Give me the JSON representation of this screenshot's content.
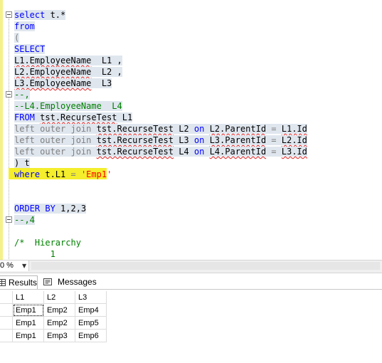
{
  "editor": {
    "lines": [
      [
        {
          "t": "select t.*",
          "c": "kw-first"
        }
      ],
      [
        {
          "t": "from",
          "c": "kw"
        }
      ],
      [
        {
          "t": "(",
          "c": "gray"
        }
      ],
      [
        {
          "t": "SELECT",
          "c": "kw"
        }
      ],
      [
        {
          "t": "L1.EmployeeName",
          "c": "err"
        },
        {
          "t": "  L1 ,",
          "c": "plain"
        }
      ],
      [
        {
          "t": "L2.EmployeeName",
          "c": "err"
        },
        {
          "t": "  L2 ,",
          "c": "plain"
        }
      ],
      [
        {
          "t": "L3.EmployeeName",
          "c": "err"
        },
        {
          "t": "  L3",
          "c": "plain"
        }
      ],
      [
        {
          "t": "--,",
          "c": "grn"
        }
      ],
      [
        {
          "t": "--L4.EmployeeName  L4",
          "c": "grn"
        }
      ],
      [
        {
          "t": "FROM",
          "c": "kw"
        },
        {
          "t": " ",
          "c": "plain"
        },
        {
          "t": "tst.RecurseTest",
          "c": "err"
        },
        {
          "t": " L1",
          "c": "plain"
        }
      ],
      [
        {
          "t": "left outer join",
          "c": "gray"
        },
        {
          "t": " ",
          "c": "plain"
        },
        {
          "t": "tst.RecurseTest",
          "c": "err"
        },
        {
          "t": " L2 ",
          "c": "plain"
        },
        {
          "t": "on",
          "c": "kw"
        },
        {
          "t": " ",
          "c": "plain"
        },
        {
          "t": "L2.ParentId",
          "c": "err"
        },
        {
          "t": " = ",
          "c": "gray"
        },
        {
          "t": "L1.Id",
          "c": "err"
        }
      ],
      [
        {
          "t": "left outer join",
          "c": "gray"
        },
        {
          "t": " ",
          "c": "plain"
        },
        {
          "t": "tst.RecurseTest",
          "c": "err"
        },
        {
          "t": " L3 ",
          "c": "plain"
        },
        {
          "t": "on",
          "c": "kw"
        },
        {
          "t": " ",
          "c": "plain"
        },
        {
          "t": "L3.ParentId",
          "c": "err"
        },
        {
          "t": " = ",
          "c": "gray"
        },
        {
          "t": "L2.Id",
          "c": "err"
        }
      ],
      [
        {
          "t": "left outer join",
          "c": "gray"
        },
        {
          "t": " ",
          "c": "plain"
        },
        {
          "t": "tst.RecurseTest",
          "c": "err"
        },
        {
          "t": " L4 ",
          "c": "plain"
        },
        {
          "t": "on",
          "c": "kw"
        },
        {
          "t": " ",
          "c": "plain"
        },
        {
          "t": "L4.ParentId",
          "c": "err"
        },
        {
          "t": " = ",
          "c": "gray"
        },
        {
          "t": "L3.Id",
          "c": "err"
        }
      ],
      [
        {
          "t": ") t",
          "c": "plain"
        }
      ],
      [
        {
          "t": "where",
          "c": "kw"
        },
        {
          "t": " t.L1 ",
          "c": "plain"
        },
        {
          "t": "=",
          "c": "gray"
        },
        {
          "t": " ",
          "c": "plain"
        },
        {
          "t": "'Emp1'",
          "c": "str"
        }
      ],
      [],
      [],
      [
        {
          "t": "ORDER BY",
          "c": "kw"
        },
        {
          "t": " 1,2,3",
          "c": "plain"
        }
      ],
      [
        {
          "t": "--,4",
          "c": "grn"
        }
      ],
      [],
      [
        {
          "t": "/*  Hierarchy",
          "c": "grn"
        }
      ],
      [
        {
          "t": "       1",
          "c": "grn"
        }
      ]
    ]
  },
  "zoom": {
    "value": "0 %"
  },
  "tabs": {
    "results": "Results",
    "messages": "Messages"
  },
  "grid": {
    "columns": [
      "L1",
      "L2",
      "L3"
    ],
    "rows": [
      [
        "Emp1",
        "Emp2",
        "Emp4"
      ],
      [
        "Emp1",
        "Emp2",
        "Emp5"
      ],
      [
        "Emp1",
        "Emp3",
        "Emp6"
      ]
    ]
  },
  "colors": {
    "keyword": "#0000ff",
    "comment": "#008000",
    "string": "#ff0000",
    "operator": "#808080",
    "line_highlight": "#f4ee2c",
    "selection": "#dfe6ee"
  }
}
